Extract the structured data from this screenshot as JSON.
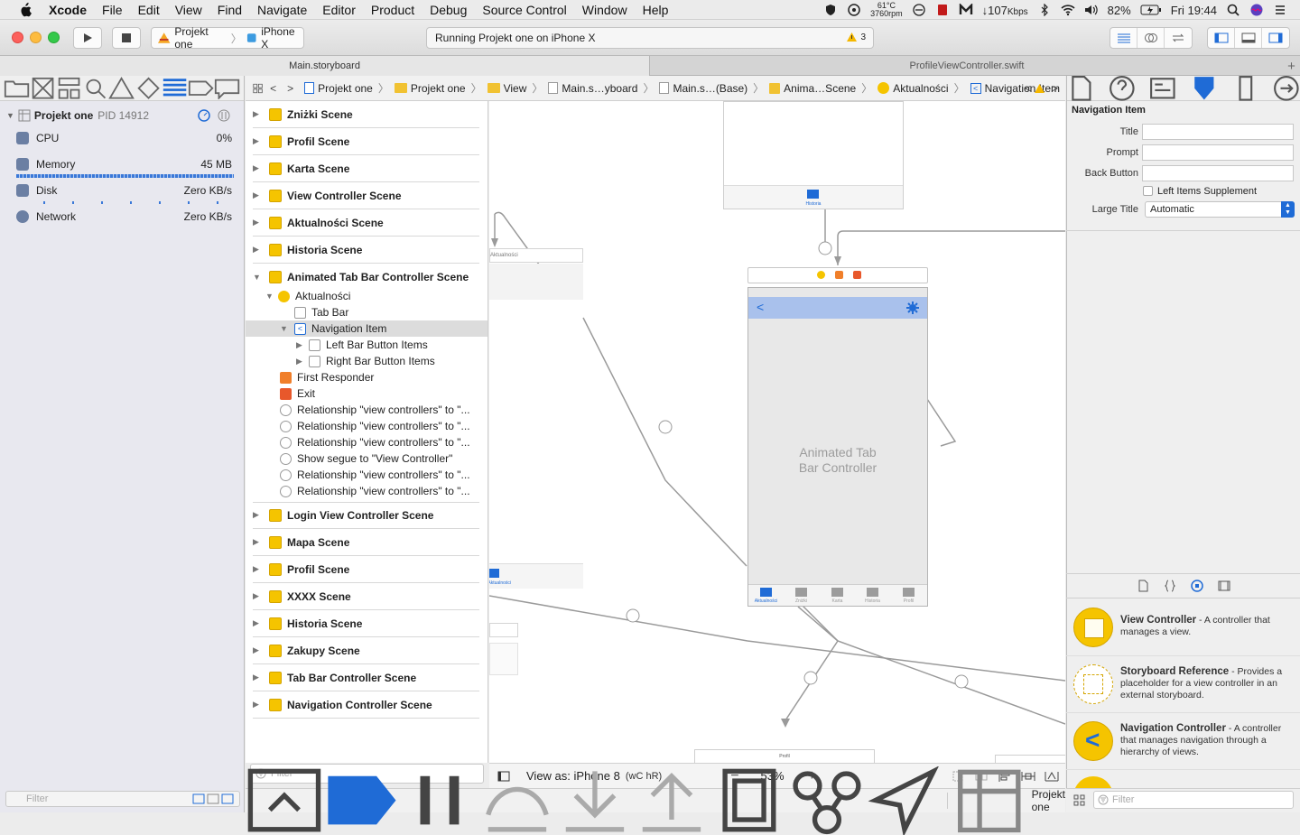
{
  "menubar": {
    "app": "Xcode",
    "items": [
      "File",
      "Edit",
      "View",
      "Find",
      "Navigate",
      "Editor",
      "Product",
      "Debug",
      "Source Control",
      "Window",
      "Help"
    ],
    "temp": "61°C",
    "rpm": "3760rpm",
    "net": "↓107",
    "net_unit": "Kbps",
    "battery": "82%",
    "clock": "Fri 19:44"
  },
  "toolbar": {
    "scheme": "Projekt one",
    "device": "iPhone X",
    "activity": "Running Projekt one on iPhone X",
    "warnings": "3"
  },
  "tabs": {
    "left": "Main.storyboard",
    "right": "ProfileViewController.swift"
  },
  "debug_nav": {
    "process": "Projekt one",
    "pid": "PID 14912",
    "cpu_label": "CPU",
    "cpu_val": "0%",
    "mem_label": "Memory",
    "mem_val": "45 MB",
    "disk_label": "Disk",
    "disk_val": "Zero KB/s",
    "net_label": "Network",
    "net_val": "Zero KB/s",
    "filter": "Filter"
  },
  "breadcrumb": [
    "Projekt one",
    "Projekt one",
    "View",
    "Main.s…yboard",
    "Main.s…(Base)",
    "Anima…Scene",
    "Aktualności",
    "Navigation Item"
  ],
  "outline": {
    "scenes_top": [
      "Zniżki Scene",
      "Profil Scene",
      "Karta Scene",
      "View Controller Scene",
      "Aktualności Scene",
      "Historia Scene",
      "Animated Tab Bar Controller Scene"
    ],
    "children": [
      "Aktualności",
      "Tab Bar",
      "Navigation Item",
      "Left Bar Button Items",
      "Right Bar Button Items",
      "First Responder",
      "Exit",
      "Relationship \"view controllers\" to \"...",
      "Relationship \"view controllers\" to \"...",
      "Relationship \"view controllers\" to \"...",
      "Show segue to \"View Controller\"",
      "Relationship \"view controllers\" to \"...",
      "Relationship \"view controllers\" to \"..."
    ],
    "scenes_bottom": [
      "Login View Controller Scene",
      "Mapa Scene",
      "Profil Scene",
      "XXXX Scene",
      "Historia Scene",
      "Zakupy Scene",
      "Tab Bar Controller Scene",
      "Navigation Controller Scene"
    ],
    "filter": "Filter"
  },
  "canvas": {
    "center_label": "Animated Tab\nBar Controller",
    "view_as": "View as: iPhone 8",
    "size_class": "(wC hR)",
    "zoom": "53%",
    "thumb_label_top": "Historia",
    "frag_label": "Aktualności",
    "frag_label2": "Aktualności",
    "bottom_label": "Profil",
    "tab_labels": [
      "Aktualności",
      "Zniżki",
      "Karta",
      "Historia",
      "Profil"
    ]
  },
  "debugbar": {
    "target": "Projekt one"
  },
  "inspector": {
    "section": "Navigation Item",
    "title_label": "Title",
    "prompt_label": "Prompt",
    "back_label": "Back Button",
    "supplement_label": "Left Items Supplement",
    "large_title_label": "Large Title",
    "large_title_value": "Automatic"
  },
  "library": {
    "items": [
      {
        "title": "View Controller",
        "desc": " - A controller that manages a view."
      },
      {
        "title": "Storyboard Reference",
        "desc": " - Provides a placeholder for a view controller in an external storyboard."
      },
      {
        "title": "Navigation Controller",
        "desc": " - A controller that manages navigation through a hierarchy of views."
      }
    ],
    "filter": "Filter"
  },
  "colors": {
    "accent": "#1f6bd6",
    "storyboard_yellow": "#f5c400",
    "nav_bar": "#a9c1ec"
  }
}
